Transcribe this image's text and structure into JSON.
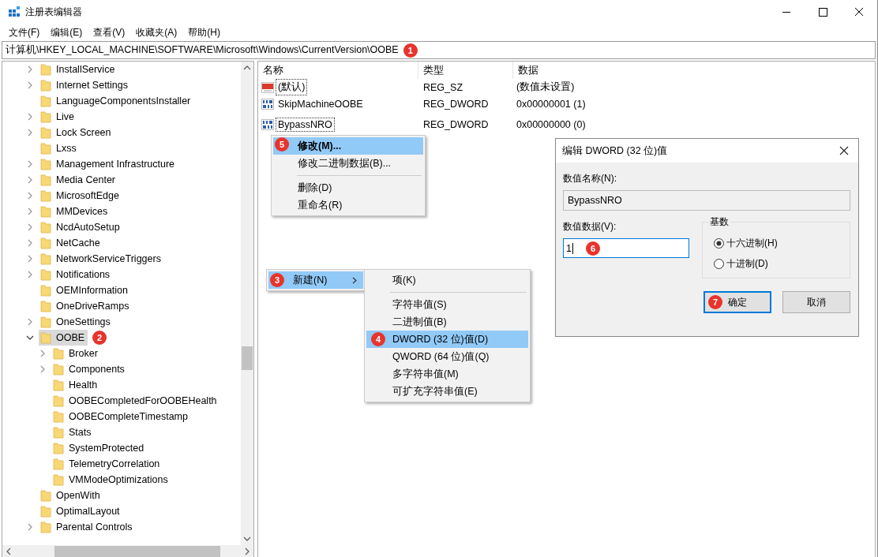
{
  "window": {
    "title": "注册表编辑器"
  },
  "menu": [
    "文件(F)",
    "编辑(E)",
    "查看(V)",
    "收藏夹(A)",
    "帮助(H)"
  ],
  "address": {
    "path": "计算机\\HKEY_LOCAL_MACHINE\\SOFTWARE\\Microsoft\\Windows\\CurrentVersion\\OOBE",
    "badge": "1"
  },
  "tree": [
    {
      "label": "InstallService",
      "kind": "branch",
      "expanded": false,
      "selected": false
    },
    {
      "label": "Internet Settings",
      "kind": "branch",
      "expanded": false,
      "selected": false
    },
    {
      "label": "LanguageComponentsInstaller",
      "kind": "leaf",
      "selected": false
    },
    {
      "label": "Live",
      "kind": "branch",
      "expanded": false,
      "selected": false
    },
    {
      "label": "Lock Screen",
      "kind": "branch",
      "expanded": false,
      "selected": false
    },
    {
      "label": "Lxss",
      "kind": "leaf",
      "selected": false
    },
    {
      "label": "Management Infrastructure",
      "kind": "branch",
      "expanded": false,
      "selected": false
    },
    {
      "label": "Media Center",
      "kind": "branch",
      "expanded": false,
      "selected": false
    },
    {
      "label": "MicrosoftEdge",
      "kind": "branch",
      "expanded": false,
      "selected": false
    },
    {
      "label": "MMDevices",
      "kind": "branch",
      "expanded": false,
      "selected": false
    },
    {
      "label": "NcdAutoSetup",
      "kind": "branch",
      "expanded": false,
      "selected": false
    },
    {
      "label": "NetCache",
      "kind": "branch",
      "expanded": false,
      "selected": false
    },
    {
      "label": "NetworkServiceTriggers",
      "kind": "branch",
      "expanded": false,
      "selected": false
    },
    {
      "label": "Notifications",
      "kind": "branch",
      "expanded": false,
      "selected": false
    },
    {
      "label": "OEMInformation",
      "kind": "leaf",
      "selected": false
    },
    {
      "label": "OneDriveRamps",
      "kind": "leaf",
      "selected": false
    },
    {
      "label": "OneSettings",
      "kind": "branch",
      "expanded": false,
      "selected": false
    },
    {
      "label": "OOBE",
      "kind": "branch",
      "expanded": true,
      "selected": true,
      "badge": "2",
      "children": [
        {
          "label": "Broker",
          "kind": "branch",
          "expanded": false,
          "selected": false
        },
        {
          "label": "Components",
          "kind": "branch",
          "expanded": false,
          "selected": false
        },
        {
          "label": "Health",
          "kind": "leaf",
          "selected": false
        },
        {
          "label": "OOBECompletedForOOBEHealth",
          "kind": "leaf",
          "selected": false
        },
        {
          "label": "OOBECompleteTimestamp",
          "kind": "leaf",
          "selected": false
        },
        {
          "label": "Stats",
          "kind": "leaf",
          "selected": false
        },
        {
          "label": "SystemProtected",
          "kind": "leaf",
          "selected": false
        },
        {
          "label": "TelemetryCorrelation",
          "kind": "leaf",
          "selected": false
        },
        {
          "label": "VMModeOptimizations",
          "kind": "leaf",
          "selected": false
        }
      ]
    },
    {
      "label": "OpenWith",
      "kind": "leaf",
      "selected": false
    },
    {
      "label": "OptimalLayout",
      "kind": "leaf",
      "selected": false
    },
    {
      "label": "Parental Controls",
      "kind": "branch",
      "expanded": false,
      "selected": false
    }
  ],
  "values": {
    "columns": [
      "名称",
      "类型",
      "数据"
    ],
    "rows": [
      {
        "kind": "string",
        "name": "(默认)",
        "type": "REG_SZ",
        "data": "(数值未设置)",
        "focused": true
      },
      {
        "kind": "binary",
        "name": "SkipMachineOOBE",
        "type": "REG_DWORD",
        "data": "0x00000001 (1)",
        "focused": false
      },
      {
        "kind": "binary",
        "name": "BypassNRO",
        "type": "REG_DWORD",
        "data": "0x00000000 (0)",
        "focused": true
      }
    ]
  },
  "context_menu": [
    {
      "label": "修改(M)...",
      "default": true,
      "selected": true,
      "badge": "5"
    },
    {
      "label": "修改二进制数据(B)...",
      "default": false,
      "selected": false
    },
    {
      "label": "删除(D)",
      "default": false,
      "selected": false,
      "separator_before": true
    },
    {
      "label": "重命名(R)",
      "default": false,
      "selected": false
    }
  ],
  "new_menu": {
    "label": "新建(N)",
    "selected": true,
    "badge": "3",
    "submenu": [
      {
        "label": "项(K)",
        "selected": false
      },
      {
        "label": "字符串值(S)",
        "selected": false,
        "separator_before": true
      },
      {
        "label": "二进制值(B)",
        "selected": false
      },
      {
        "label": "DWORD (32 位)值(D)",
        "selected": true,
        "badge": "4"
      },
      {
        "label": "QWORD (64 位)值(Q)",
        "selected": false
      },
      {
        "label": "多字符串值(M)",
        "selected": false
      },
      {
        "label": "可扩充字符串值(E)",
        "selected": false
      }
    ]
  },
  "dialog": {
    "title": "编辑 DWORD (32 位)值",
    "name_label": "数值名称(N):",
    "name_value": "BypassNRO",
    "data_label": "数值数据(V):",
    "data_value": "1",
    "data_badge": "6",
    "base_label": "基数",
    "bases": [
      {
        "label": "十六进制(H)",
        "selected": true
      },
      {
        "label": "十进制(D)",
        "selected": false
      }
    ],
    "buttons": [
      {
        "label": "确定",
        "default": true,
        "badge": "7"
      },
      {
        "label": "取消",
        "default": false
      }
    ]
  }
}
